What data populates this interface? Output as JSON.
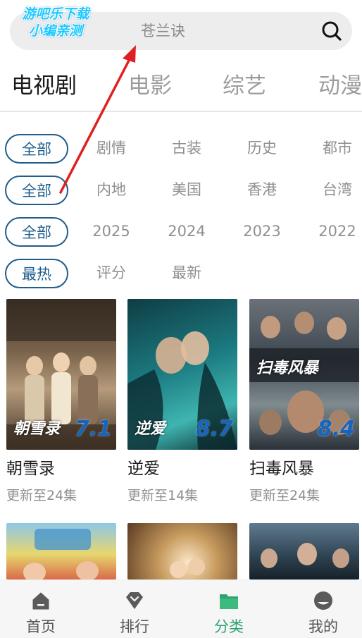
{
  "watermark": {
    "line1": "游吧乐下载",
    "line2": "小编亲测"
  },
  "search": {
    "placeholder": "苍兰诀"
  },
  "category_tabs": [
    {
      "label": "电视剧",
      "active": true
    },
    {
      "label": "电影",
      "active": false
    },
    {
      "label": "综艺",
      "active": false
    },
    {
      "label": "动漫",
      "active": false
    }
  ],
  "filters": {
    "genre": [
      "全部",
      "剧情",
      "古装",
      "历史",
      "都市"
    ],
    "region": [
      "全部",
      "内地",
      "美国",
      "香港",
      "台湾"
    ],
    "year": [
      "全部",
      "2025",
      "2024",
      "2023",
      "2022"
    ],
    "sort": [
      "最热",
      "评分",
      "最新"
    ]
  },
  "shows": [
    {
      "title": "朝雪录",
      "subtitle": "更新至24集",
      "rating": "7.1",
      "poster_text": "朝雪录"
    },
    {
      "title": "逆爱",
      "subtitle": "更新至14集",
      "rating": "8.7",
      "poster_text": "逆爱"
    },
    {
      "title": "扫毒风暴",
      "subtitle": "更新至24集",
      "rating": "8.4",
      "poster_text": "扫毒风暴"
    }
  ],
  "bottom_nav": [
    {
      "label": "首页",
      "icon": "home-icon",
      "active": false
    },
    {
      "label": "排行",
      "icon": "ranking-icon",
      "active": false
    },
    {
      "label": "分类",
      "icon": "folder-icon",
      "active": true
    },
    {
      "label": "我的",
      "icon": "profile-icon",
      "active": false
    }
  ],
  "colors": {
    "accent_blue": "#1e5d8c",
    "rating_blue": "#1565c0",
    "nav_active_green": "#2ea36f",
    "annotation_red": "#e02020"
  }
}
